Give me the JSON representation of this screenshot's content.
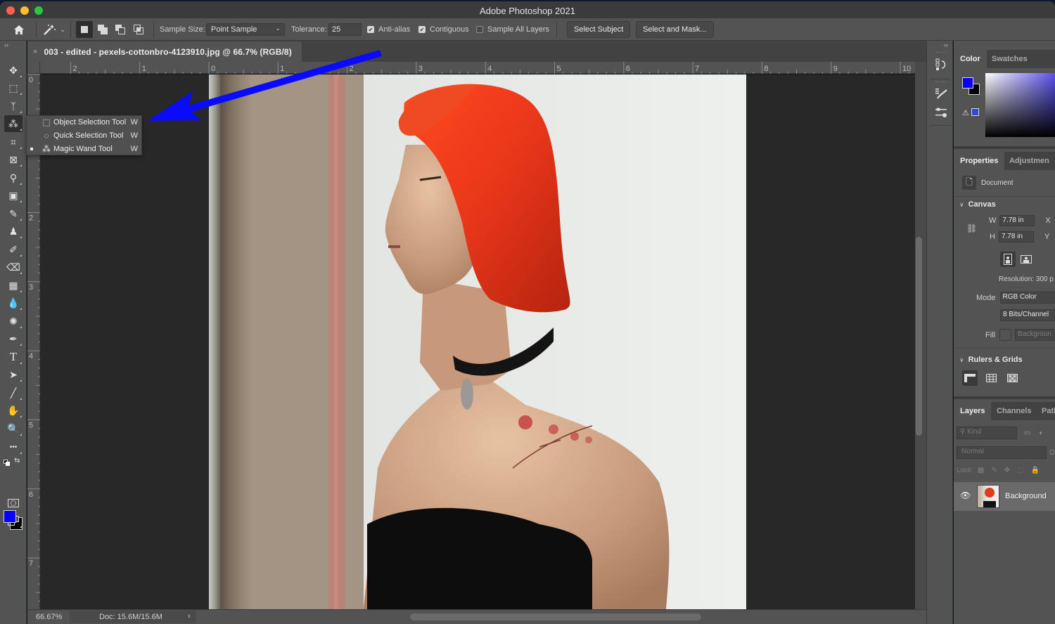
{
  "window": {
    "title": "Adobe Photoshop 2021",
    "traffic_lights": [
      "close",
      "minimize",
      "zoom"
    ]
  },
  "options_bar": {
    "home_icon": "home-icon",
    "tool_preset_icon": "magic-wand-icon",
    "selection_modes": [
      "new-selection",
      "add-to-selection",
      "subtract-from-selection",
      "intersect-with-selection"
    ],
    "active_mode": "new-selection",
    "sample_size_label": "Sample Size:",
    "sample_size_value": "Point Sample",
    "tolerance_label": "Tolerance:",
    "tolerance_value": "25",
    "anti_alias_label": "Anti-alias",
    "anti_alias_checked": true,
    "contiguous_label": "Contiguous",
    "contiguous_checked": true,
    "sample_all_layers_label": "Sample All Layers",
    "sample_all_layers_checked": false,
    "select_subject_label": "Select Subject",
    "select_and_mask_label": "Select and Mask..."
  },
  "document": {
    "tab_title": "003 - edited - pexels-cottonbro-4123910.jpg @ 66.7% (RGB/8)",
    "close_glyph": "×",
    "ruler_h_labels": [
      "2",
      "1",
      "0",
      "1",
      "2",
      "3",
      "4",
      "5",
      "6",
      "7",
      "8",
      "9",
      "10"
    ],
    "ruler_v_labels": [
      "0",
      "1",
      "2",
      "3",
      "4",
      "5",
      "6",
      "7"
    ],
    "zoom_level": "66.67%",
    "doc_size": "Doc: 15.6M/15.6M",
    "status_arrow": "›"
  },
  "toolbar": {
    "collapse_glyph": "››",
    "tools": [
      {
        "name": "move-tool",
        "glyph": "✥"
      },
      {
        "name": "rectangular-marquee-tool",
        "glyph": "⬚"
      },
      {
        "name": "lasso-tool",
        "glyph": "ᛉ"
      },
      {
        "name": "magic-wand-tool",
        "glyph": "⁂",
        "active": true
      },
      {
        "name": "crop-tool",
        "glyph": "⌗"
      },
      {
        "name": "frame-tool",
        "glyph": "⊠"
      },
      {
        "name": "eyedropper-tool",
        "glyph": "⚲"
      },
      {
        "name": "spot-healing-tool",
        "glyph": "▣"
      },
      {
        "name": "brush-tool",
        "glyph": "✎"
      },
      {
        "name": "clone-stamp-tool",
        "glyph": "♟"
      },
      {
        "name": "history-brush-tool",
        "glyph": "✐"
      },
      {
        "name": "eraser-tool",
        "glyph": "⌫"
      },
      {
        "name": "gradient-tool",
        "glyph": "▦"
      },
      {
        "name": "blur-tool",
        "glyph": "💧"
      },
      {
        "name": "dodge-tool",
        "glyph": "✺"
      },
      {
        "name": "pen-tool",
        "glyph": "✒"
      },
      {
        "name": "type-tool",
        "glyph": "T"
      },
      {
        "name": "path-selection-tool",
        "glyph": "➤"
      },
      {
        "name": "line-tool",
        "glyph": "╱"
      },
      {
        "name": "hand-tool",
        "glyph": "✋"
      },
      {
        "name": "zoom-tool",
        "glyph": "🔍"
      },
      {
        "name": "edit-toolbar",
        "glyph": "•••"
      }
    ],
    "foreground_color": "#0a00ff",
    "background_color": "#000000"
  },
  "tool_flyout": {
    "items": [
      {
        "label": "Object Selection Tool",
        "shortcut": "W",
        "icon": "object-selection-icon",
        "selected": false
      },
      {
        "label": "Quick Selection Tool",
        "shortcut": "W",
        "icon": "quick-selection-icon",
        "selected": false
      },
      {
        "label": "Magic Wand Tool",
        "shortcut": "W",
        "icon": "magic-wand-icon",
        "selected": true
      }
    ]
  },
  "annotation": {
    "arrow_color": "#0a0aff",
    "points_to": "Object Selection Tool"
  },
  "right_dock": {
    "collapse_glyph": "‹‹",
    "buttons": [
      "history-icon",
      "brush-settings-icon",
      "adjustments-presets-icon"
    ]
  },
  "color_panel": {
    "tabs": [
      "Color",
      "Swatches"
    ],
    "active_tab": "Color",
    "foreground": "#0a00ff",
    "background": "#000000",
    "gamut_swatch": "#3049d6"
  },
  "properties_panel": {
    "tabs": [
      "Properties",
      "Adjustmen"
    ],
    "active_tab": "Properties",
    "doc_label": "Document",
    "canvas_title": "Canvas",
    "w_label": "W",
    "w_value": "7.78 in",
    "h_label": "H",
    "h_value": "7.78 in",
    "x_label": "X",
    "y_label": "Y",
    "resolution": "Resolution: 300 p",
    "mode_label": "Mode",
    "mode_value": "RGB Color",
    "bits_value": "8 Bits/Channel",
    "fill_label": "Fill",
    "fill_value": "Backgroun",
    "rulers_title": "Rulers & Grids"
  },
  "layers_panel": {
    "tabs": [
      "Layers",
      "Channels",
      "Path"
    ],
    "active_tab": "Layers",
    "filter_placeholder": "Kind",
    "blend_mode": "Normal",
    "opacity_label": "O",
    "lock_label": "Lock:",
    "layers": [
      {
        "name": "Background",
        "visible": true
      }
    ]
  }
}
